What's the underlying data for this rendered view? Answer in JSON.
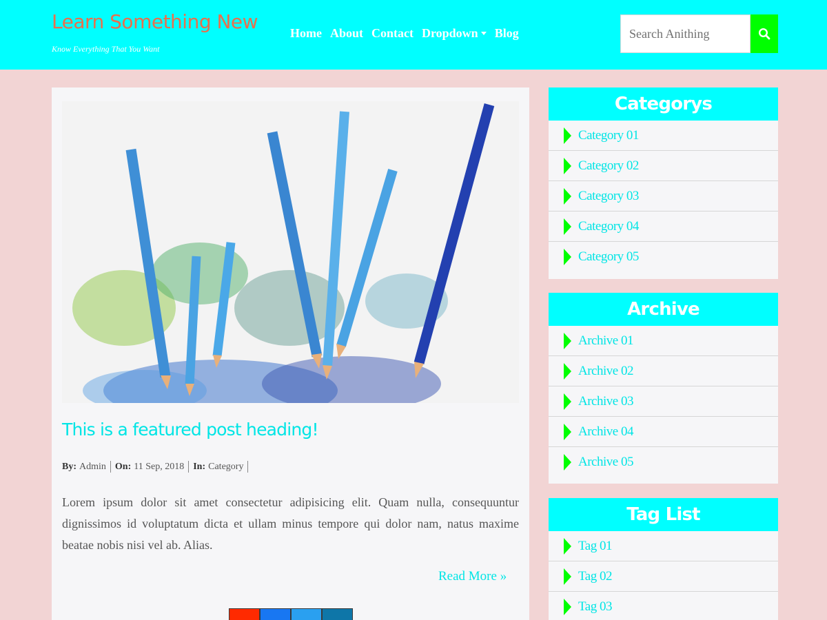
{
  "brand": {
    "title": "Learn Something New",
    "tagline": "Know Everything That You Want"
  },
  "nav": {
    "items": [
      "Home",
      "About",
      "Contact",
      "Dropdown",
      "Blog"
    ]
  },
  "search": {
    "placeholder": "Search Anithing",
    "icon": "search-icon"
  },
  "post": {
    "heading": "This is a featured post heading!",
    "meta": {
      "by_label": "By:",
      "author": "Admin",
      "on_label": "On:",
      "date": "11 Sep, 2018",
      "in_label": "In:",
      "category": "Category"
    },
    "body": "Lorem ipsum dolor sit amet consectetur adipisicing elit. Quam nulla, consequuntur dignissimos id voluptatum dicta et ullam minus tempore qui dolor nam, natus maxime beatae nobis nisi vel ab. Alias.",
    "read_more": "Read More »"
  },
  "share_colors": [
    "#ff2a00",
    "#1877f2",
    "#2aa0f0",
    "#0e76a8"
  ],
  "colors": {
    "accent": "#00ffff",
    "link": "#00e5e5",
    "brand": "#e8704d",
    "search_button": "#00ff00",
    "page_bg": "#f2d4d4"
  },
  "sidebar": {
    "categories": {
      "title": "Categorys",
      "items": [
        "Category 01",
        "Category 02",
        "Category 03",
        "Category 04",
        "Category 05"
      ]
    },
    "archive": {
      "title": "Archive",
      "items": [
        "Archive 01",
        "Archive 02",
        "Archive 03",
        "Archive 04",
        "Archive 05"
      ]
    },
    "tags": {
      "title": "Tag List",
      "items": [
        "Tag 01",
        "Tag 02",
        "Tag 03"
      ]
    }
  }
}
